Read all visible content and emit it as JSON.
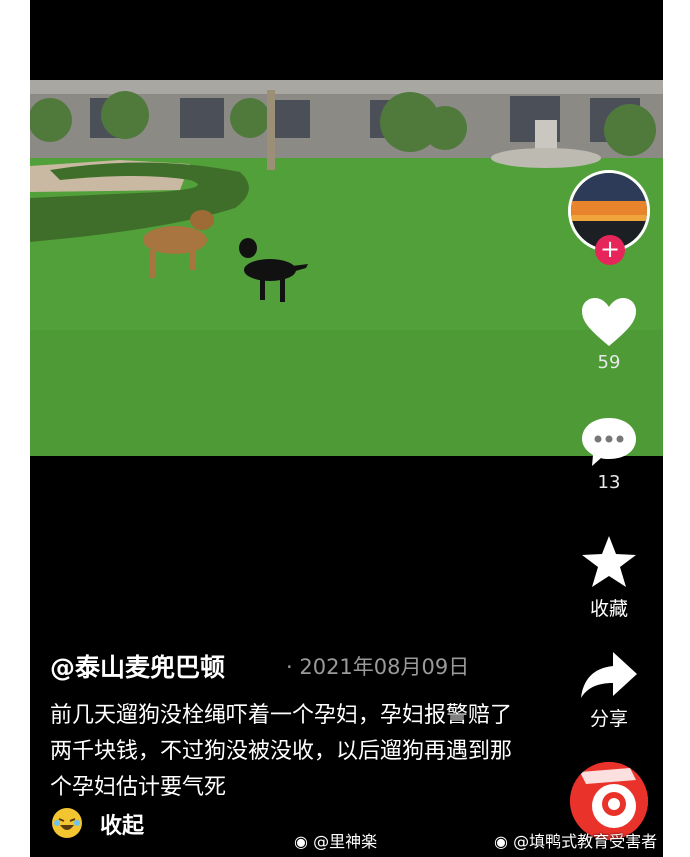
{
  "post": {
    "author": "@泰山麦兜巴顿",
    "date": "· 2021年08月09日",
    "caption": "前几天遛狗没栓绳吓着一个孕妇，孕妇报警赔了两千块钱，不过狗没被没收，以后遛狗再遇到那个孕妇估计要气死",
    "collapse_label": "收起",
    "emoji_icon": "laughing-tears-emoji"
  },
  "actions": {
    "follow_symbol": "+",
    "like_count": "59",
    "comment_count": "13",
    "favorite_label": "收藏",
    "share_label": "分享"
  },
  "watermarks": {
    "left": "@里神楽",
    "right": "@填鸭式教育受害者"
  },
  "colors": {
    "background": "#000000",
    "follow_button": "#e6265a",
    "music_disc": "#e8322a"
  }
}
